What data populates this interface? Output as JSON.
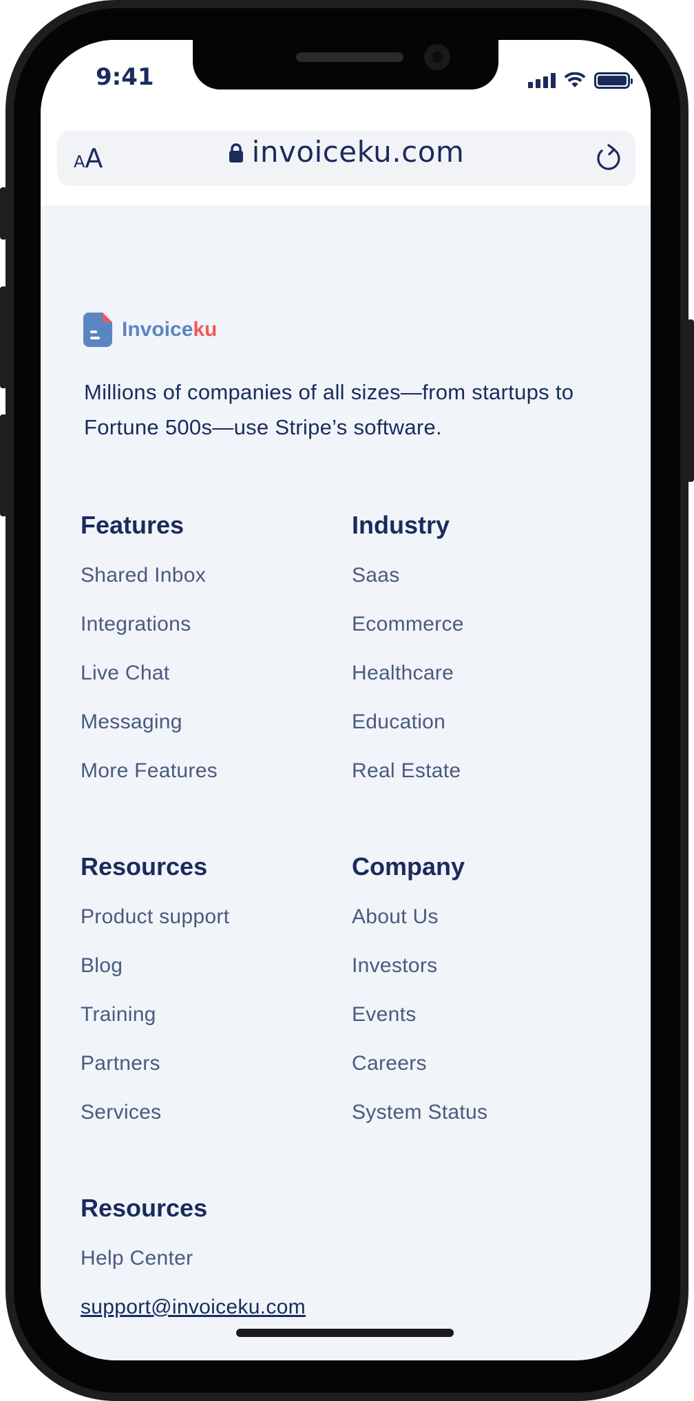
{
  "status_bar": {
    "time": "9:41",
    "icons": [
      "signal-icon",
      "wifi-icon",
      "battery-icon"
    ]
  },
  "browser": {
    "text_size_small": "A",
    "text_size_big": "A",
    "url": "invoiceku.com",
    "icons": [
      "lock-icon",
      "reload-icon"
    ]
  },
  "brand": {
    "name_part1": "Invoice",
    "name_part2": "ku",
    "colors": {
      "primary": "#5b85c1",
      "accent": "#ef5a57"
    }
  },
  "tagline": "Millions of companies of all sizes—from startups to Fortune 500s—use Stripe’s software.",
  "footer": {
    "features": {
      "heading": "Features",
      "items": [
        "Shared Inbox",
        "Integrations",
        "Live Chat",
        "Messaging",
        "More Features"
      ]
    },
    "industry": {
      "heading": "Industry",
      "items": [
        "Saas",
        "Ecommerce",
        "Healthcare",
        "Education",
        "Real Estate"
      ]
    },
    "resources": {
      "heading": "Resources",
      "items": [
        "Product support",
        "Blog",
        "Training",
        "Partners",
        "Services"
      ]
    },
    "company": {
      "heading": "Company",
      "items": [
        "About Us",
        "Investors",
        "Events",
        "Careers",
        "System Status"
      ]
    },
    "support": {
      "heading": "Resources",
      "items": [
        "Help Center"
      ],
      "email": "support@invoiceku.com"
    }
  },
  "colors": {
    "heading": "#1a2b5c",
    "link": "#4a5a7e",
    "background": "#f1f4f9"
  }
}
